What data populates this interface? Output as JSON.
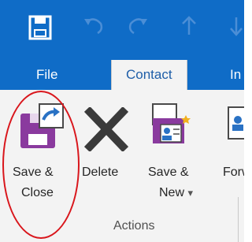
{
  "quick_access": {
    "icons": [
      "save-icon",
      "undo-icon",
      "redo-icon",
      "up-arrow-icon",
      "down-arrow-icon"
    ]
  },
  "tabs": [
    {
      "label": "File"
    },
    {
      "label": "Contact",
      "active": true
    },
    {
      "label": "In"
    }
  ],
  "ribbon": {
    "buttons": [
      {
        "line1": "Save &",
        "line2": "Close"
      },
      {
        "line1": "Delete",
        "line2": ""
      },
      {
        "line1": "Save &",
        "line2": "New",
        "dropdown": "▾"
      },
      {
        "line1": "Forw",
        "line2": ""
      }
    ],
    "group_label": "Actions"
  },
  "colors": {
    "title_bar": "#0f6cc7",
    "ribbon_bg": "#f3f3f3",
    "highlight_circle": "#d9161c"
  }
}
